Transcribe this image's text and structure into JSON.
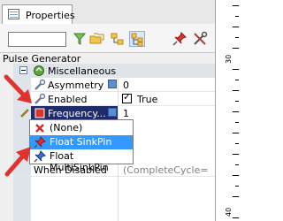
{
  "tabs": [
    {
      "label": "Properties"
    }
  ],
  "toolbar": {
    "search_value": ""
  },
  "grid": {
    "title": "Pulse Generator",
    "category": "Miscellaneous",
    "rows": [
      {
        "name": "Asymmetry",
        "value": "0"
      },
      {
        "name": "Enabled",
        "value": "True"
      },
      {
        "name": "Frequency...",
        "value": "1"
      },
      {
        "name": "When Disabled",
        "value": "(CompleteCycle="
      }
    ]
  },
  "dropdown": {
    "options": [
      {
        "label": "(None)"
      },
      {
        "label": "Float SinkPin"
      },
      {
        "label": "Float MultiSinkPin"
      }
    ],
    "selected_index": 1
  },
  "ruler": {
    "labels": [
      "30",
      "40"
    ]
  },
  "colors": {
    "selection": "#3399ff",
    "frequency_row": "#1f2b6b",
    "arrow": "#e0332e"
  }
}
